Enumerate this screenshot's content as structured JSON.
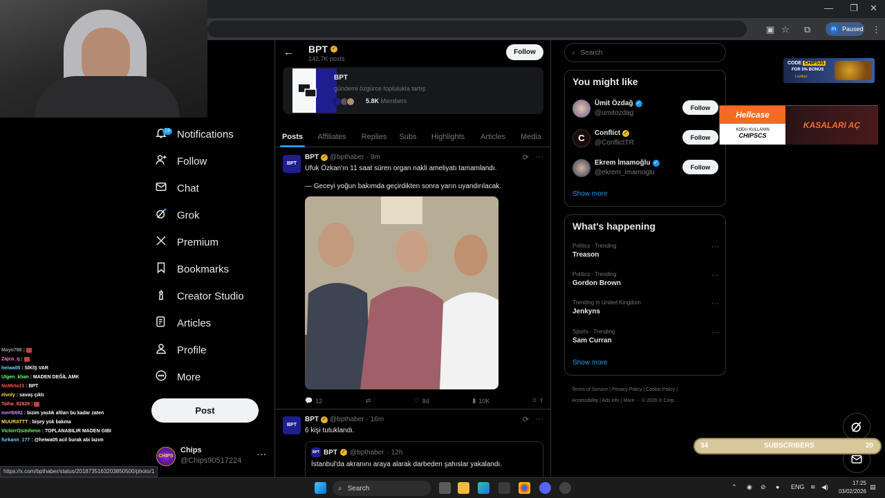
{
  "browser": {
    "profile_status": "Paused",
    "profile_initial": "m",
    "window_controls": [
      "—",
      "❐",
      "✕"
    ],
    "hover_url": "https://x.com/bpthaber/status/2018735163203850500/photo/1"
  },
  "nav": {
    "notifications_badge": "19",
    "items": [
      {
        "label": "Notifications",
        "icon": "bell-icon"
      },
      {
        "label": "Follow",
        "icon": "person-add-icon"
      },
      {
        "label": "Chat",
        "icon": "envelope-icon"
      },
      {
        "label": "Grok",
        "icon": "grok-icon"
      },
      {
        "label": "Premium",
        "icon": "x-logo-icon"
      },
      {
        "label": "Bookmarks",
        "icon": "bookmark-icon"
      },
      {
        "label": "Creator Studio",
        "icon": "creator-studio-icon"
      },
      {
        "label": "Articles",
        "icon": "articles-icon"
      },
      {
        "label": "Profile",
        "icon": "person-icon"
      },
      {
        "label": "More",
        "icon": "more-circle-icon"
      }
    ],
    "post_label": "Post",
    "account": {
      "name": "Chips",
      "handle": "@Chips90517224",
      "avatar_text": "CHIPS"
    }
  },
  "header": {
    "title": "BPT",
    "subtitle": "142.7K posts",
    "follow_label": "Follow"
  },
  "community": {
    "name": "BPT",
    "description": "gündemi özgürce toplulukla tartış",
    "members_count": "5.8K",
    "members_label": "Members"
  },
  "tabs": [
    "Posts",
    "Affiliates",
    "Replies",
    "Subs",
    "Highlights",
    "Articles",
    "Media"
  ],
  "tweets": [
    {
      "avatar_text": "BPT",
      "name": "BPT",
      "handle": "@bpthaber",
      "time": "· 9m",
      "line1": "Ufuk Özkan'ın 11 saat süren organ nakli ameliyatı tamamlandı.",
      "line2": "— Geceyi yoğun bakımda geçirdikten sonra yarın uyandırılacak.",
      "replies": "12",
      "likes": "84",
      "views": "10K"
    },
    {
      "avatar_text": "BPT",
      "name": "BPT",
      "handle": "@bpthaber",
      "time": "· 16m",
      "line1": "6 kişi tutuklandı.",
      "quote": {
        "name": "BPT",
        "handle": "@bpthaber",
        "time": "· 12h",
        "text": "İstanbul'da akranını araya alarak darbeden şahıslar yakalandı."
      }
    }
  ],
  "search": {
    "placeholder": "Search"
  },
  "you_might_like": {
    "title": "You might like",
    "items": [
      {
        "name": "Ümit Özdağ",
        "handle": "@umitozdag",
        "badge": "blue",
        "follow": "Follow"
      },
      {
        "name": "Conflict",
        "handle": "@ConflictTR",
        "badge": "gold",
        "follow": "Follow"
      },
      {
        "name": "Ekrem İmamoğlu",
        "handle": "@ekrem_imamoglu",
        "badge": "blue",
        "follow": "Follow"
      }
    ],
    "show_more": "Show more"
  },
  "whats_happening": {
    "title": "What's happening",
    "items": [
      {
        "context": "Politics · Trending",
        "topic": "Treason"
      },
      {
        "context": "Politics · Trending",
        "topic": "Gordon Brown"
      },
      {
        "context": "Trending in United Kingdom",
        "topic": "Jenkyns"
      },
      {
        "context": "Sports · Trending",
        "topic": "Sam Curran"
      }
    ],
    "show_more": "Show more"
  },
  "footer": {
    "links_line1": "Terms of Service  |  Privacy Policy  |  Cookie Policy  |",
    "links_line2": "Accessibility  |  Ads info  |  More ···  © 2026 X Corp."
  },
  "chat": [
    {
      "user": "Mayo788",
      "color": "#9b9b9b",
      "msg": ""
    },
    {
      "user": "Zajco_q",
      "color": "#ff7ad9",
      "msg": ""
    },
    {
      "user": "heiwa05",
      "color": "#7ad0ff",
      "msg": "SİKİŞ VAR"
    },
    {
      "user": "Ulgen_khan",
      "color": "#6cff6c",
      "msg": "MADEN DEĞİL AMK"
    },
    {
      "user": "NoMeta33",
      "color": "#ff4d4d",
      "msg": "BPT"
    },
    {
      "user": "elvnly",
      "color": "#ffd84d",
      "msg": "savaş çıktı"
    },
    {
      "user": "Talha_82828",
      "color": "#ff6b6b",
      "msg": ""
    },
    {
      "user": "mert6692",
      "color": "#c58cff",
      "msg": "bizim yastık altları bu kadar zaten"
    },
    {
      "user": "MUURATTT",
      "color": "#ffd84d",
      "msg": "bişey yok bakma"
    },
    {
      "user": "VictorrOsimhenn",
      "color": "#6cff6c",
      "msg": "TOPLANABILIR MADEN GIBI"
    },
    {
      "user": "furkann_177",
      "color": "#7ad0ff",
      "msg": "@heiwa05 acil burak abi lazım"
    }
  ],
  "ads": {
    "chips_code": "CODE",
    "chips_code_value": "CHIPS31",
    "chips_bonus": "FOR 5% BONUS",
    "chips_brand": "Lootbox",
    "hellcase_brand": "Hellcase",
    "hellcase_code_label": "KODU KULLANIN",
    "hellcase_code": "CHIPSCS",
    "hellcase_cta": "KASALARI AÇ"
  },
  "subscribers": {
    "left": "34",
    "label": "SUBSCRIBERS",
    "right": "20"
  },
  "taskbar": {
    "search_label": "Search",
    "language": "ENG",
    "time": "17:25",
    "date": "03/02/2026"
  }
}
